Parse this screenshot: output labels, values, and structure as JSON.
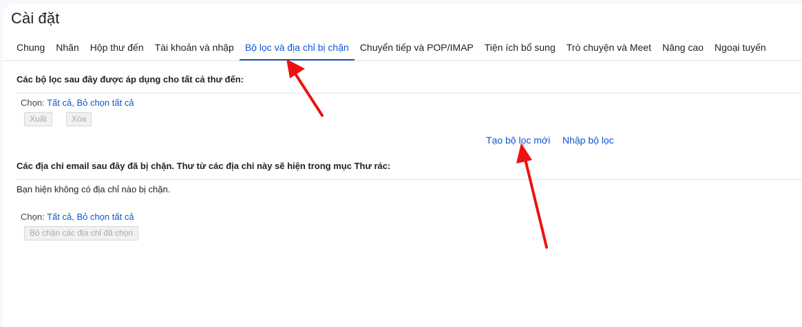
{
  "page": {
    "title": "Cài đặt"
  },
  "tabs": [
    {
      "label": "Chung",
      "active": false
    },
    {
      "label": "Nhãn",
      "active": false
    },
    {
      "label": "Hộp thư đến",
      "active": false
    },
    {
      "label": "Tài khoản và nhập",
      "active": false
    },
    {
      "label": "Bộ lọc và địa chỉ bị chặn",
      "active": true
    },
    {
      "label": "Chuyển tiếp và POP/IMAP",
      "active": false
    },
    {
      "label": "Tiện ích bổ sung",
      "active": false
    },
    {
      "label": "Trò chuyện và Meet",
      "active": false
    },
    {
      "label": "Nâng cao",
      "active": false
    },
    {
      "label": "Ngoại tuyến",
      "active": false
    }
  ],
  "filters": {
    "heading": "Các bộ lọc sau đây được áp dụng cho tất cả thư đến:",
    "select_prefix": "Chọn: ",
    "select_all": "Tất cả",
    "separator": ", ",
    "deselect_all": "Bỏ chọn tất cả",
    "export_label": "Xuất",
    "delete_label": "Xóa",
    "create_filter_label": "Tạo bộ lọc mới",
    "import_filter_label": "Nhập bộ lọc"
  },
  "blocked": {
    "heading": "Các địa chỉ email sau đây đã bị chặn. Thư từ các địa chỉ này sẽ hiện trong mục Thư rác:",
    "empty_message": "Bạn hiện không có địa chỉ nào bị chặn.",
    "select_prefix": "Chọn: ",
    "select_all": "Tất cả",
    "separator": ", ",
    "deselect_all": "Bỏ chọn tất cả",
    "unblock_label": "Bỏ chặn các địa chỉ đã chọn"
  },
  "colors": {
    "accent": "#0b57d0",
    "annotation_arrow": "#ee1111"
  }
}
